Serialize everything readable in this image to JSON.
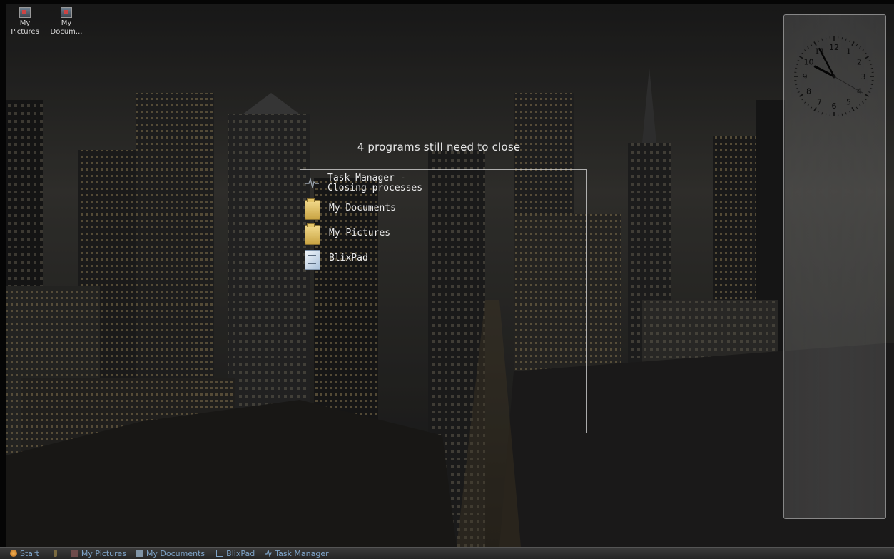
{
  "desktop": {
    "icons": [
      {
        "label": "My Pictures"
      },
      {
        "label": "My Docum..."
      }
    ]
  },
  "shutdown": {
    "title": "4 programs still need to close",
    "programs": [
      {
        "name": "Task Manager - Closing processes",
        "icon": "pulse-icon"
      },
      {
        "name": "My Documents",
        "icon": "folder-icon"
      },
      {
        "name": "My Pictures",
        "icon": "folder-icon"
      },
      {
        "name": "BlixPad",
        "icon": "notepad-icon"
      }
    ]
  },
  "clock": {
    "numbers": [
      "12",
      "1",
      "2",
      "3",
      "4",
      "5",
      "6",
      "7",
      "8",
      "9",
      "10",
      "11"
    ],
    "time": {
      "hour": 9,
      "minute": 55,
      "second": 20
    }
  },
  "taskbar": {
    "start": "Start",
    "items": [
      "My Pictures",
      "My Documents",
      "BlixPad",
      "Task Manager"
    ]
  },
  "colors": {
    "taskbar_text": "#7fa4c8",
    "overlay_text": "#e6e6e6"
  }
}
